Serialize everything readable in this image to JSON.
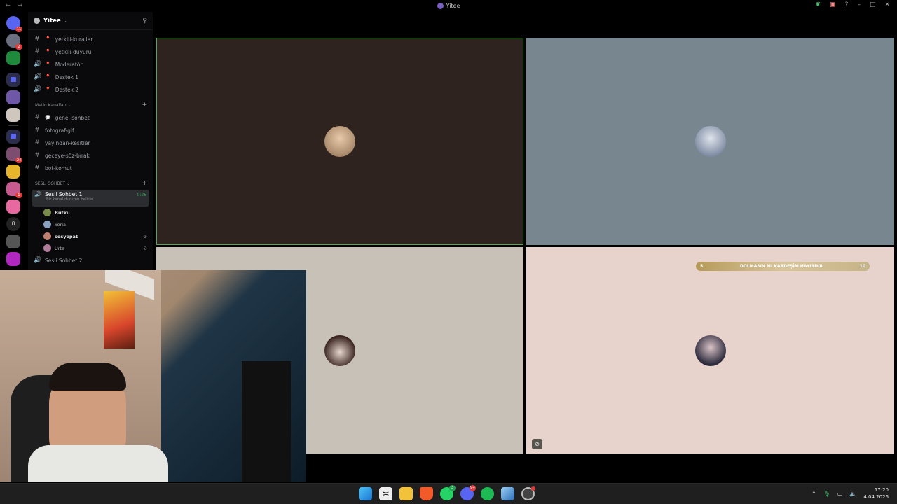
{
  "window": {
    "title": "Yitee",
    "nav": "← →"
  },
  "server_rail": {
    "badges": [
      "11",
      "2",
      "24",
      "1",
      "0"
    ]
  },
  "server": {
    "name": "Yitee"
  },
  "channels_top": [
    {
      "icon": "#",
      "name": "yetkili-kurallar"
    },
    {
      "icon": "#",
      "name": "yetkili-duyuru"
    },
    {
      "icon": "🔊",
      "name": "Moderatör"
    },
    {
      "icon": "🔊",
      "name": "Destek 1"
    },
    {
      "icon": "🔊",
      "name": "Destek 2"
    }
  ],
  "text_category": {
    "label": "Metin Kanalları ⌄"
  },
  "text_channels": [
    {
      "name": "genel-sohbet"
    },
    {
      "name": "fotograf-gif"
    },
    {
      "name": "yayından-kesitler"
    },
    {
      "name": "geceye-söz-bırak"
    },
    {
      "name": "bot-komut"
    }
  ],
  "voice_category": {
    "label": "SESLİ SOHBET ⌄"
  },
  "active_voice": {
    "name": "Sesli Sohbet 1",
    "status": "Bir kanal durumu belirle",
    "time": "0:26"
  },
  "voice_users": [
    {
      "name": "Butku",
      "bold": true,
      "muted": false,
      "color": "#7a8c4a"
    },
    {
      "name": "keria",
      "bold": false,
      "muted": false,
      "color": "#8aa0c0"
    },
    {
      "name": "sosyopat",
      "bold": true,
      "muted": true,
      "color": "#c08070"
    },
    {
      "name": "Urte",
      "bold": false,
      "muted": true,
      "color": "#b07a9a"
    }
  ],
  "next_voice": {
    "name": "Sesli Sohbet 2"
  },
  "stage_banner": {
    "left": "5",
    "text": "DOLMASIN MI KARDEŞİM HAYIRDIR",
    "right": "10"
  },
  "taskbar": {
    "badges": {
      "whatsapp": "3",
      "discord": "9+"
    },
    "time": "17:20",
    "date": "4.04.2026"
  }
}
